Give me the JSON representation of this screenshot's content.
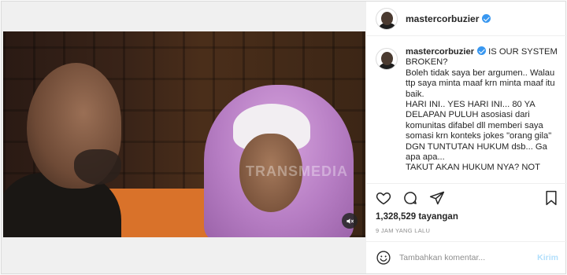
{
  "post": {
    "media": {
      "watermark": "TRANSMEDIA",
      "sound_icon": "speaker-muted-icon"
    },
    "header": {
      "username": "mastercorbuzier",
      "verified": true
    },
    "caption": {
      "username": "mastercorbuzier",
      "lines": [
        "IS OUR SYSTEM BROKEN?",
        "Boleh tidak saya ber argumen.. Walau ttp saya minta maaf krn minta maaf itu baik.",
        "HARI INI.. YES HARI INI... 80 YA DELAPAN PULUH asosiasi dari komunitas difabel dll memberi saya somasi krn konteks jokes \"orang gila\" DGN TUNTUTAN HUKUM dsb... Ga apa apa...",
        "TAKUT AKAN HUKUM NYA? NOT"
      ]
    },
    "actions": {
      "icons": [
        "heart-icon",
        "comment-icon",
        "share-icon",
        "bookmark-icon"
      ],
      "views": "1,328,529 tayangan",
      "timestamp": "9 JAM YANG LALU"
    },
    "comment_box": {
      "placeholder": "Tambahkan komentar...",
      "post_label": "Kirim",
      "emoji_icon": "smiley-icon"
    }
  },
  "colors": {
    "verified_blue": "#3897f0",
    "post_button_disabled": "#b2dffc",
    "muted_text": "#8e8e8e",
    "border": "#efefef"
  }
}
